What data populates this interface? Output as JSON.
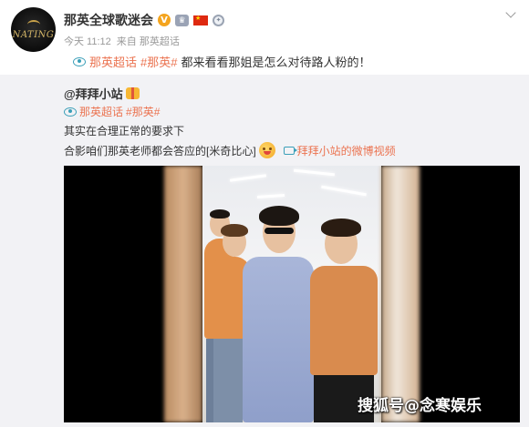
{
  "post": {
    "author_name": "那英全球歌迷会",
    "avatar_logo_text": "NATING",
    "meta_time": "今天 11:12",
    "meta_source": "来自 那英超话",
    "text_topic1": "那英超话",
    "text_topic2": "#那英#",
    "text_body": "都来看看那姐是怎么对待路人粉的！"
  },
  "repost": {
    "orig_user": "@拜拜小站",
    "topic1": "那英超话",
    "topic2": "#那英#",
    "line1": "其实在合理正常的要求下",
    "line2": "合影咱们那英老师都会答应的[米奇比心]",
    "video_link": "拜拜小站的微博视频"
  },
  "watermark": "搜狐号@念寒娱乐",
  "colors": {
    "link": "#eb7350",
    "topic_icon": "#3a9fb8",
    "verified_badge": "#f4a41e",
    "repost_bg": "#f2f2f5"
  },
  "icons": [
    "chevron-down-icon",
    "verified-icon",
    "member-crown-icon",
    "china-flag-icon",
    "medal-icon",
    "topic-icon",
    "gift-icon",
    "emoji-icon",
    "video-icon"
  ]
}
